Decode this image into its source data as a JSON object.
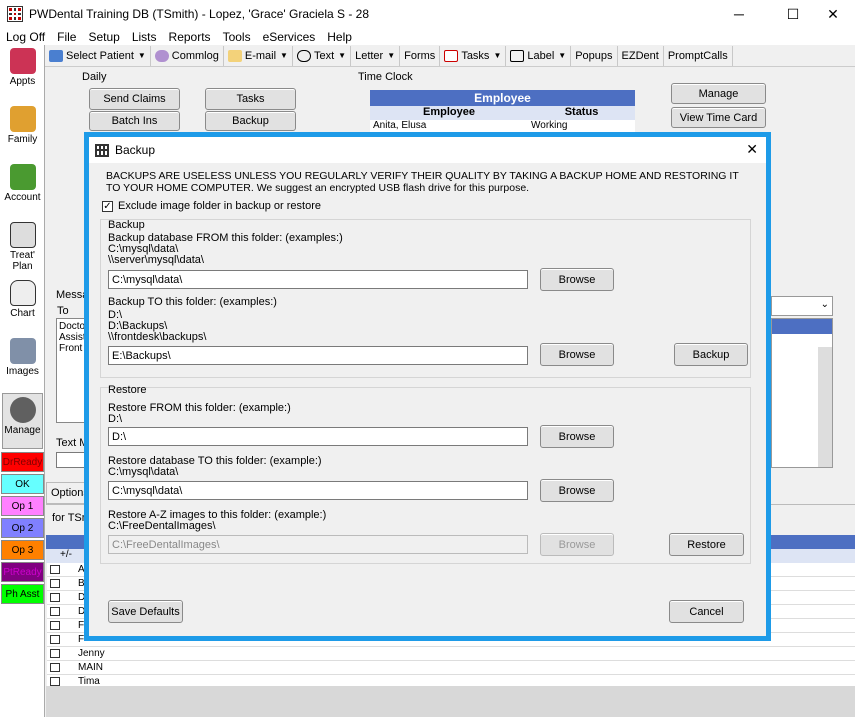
{
  "window": {
    "title": "PWDental Training DB (TSmith) - Lopez, 'Grace' Graciela S - 28",
    "minimize": "─",
    "maximize": "☐",
    "close": "✕"
  },
  "menu": [
    "Log Off",
    "File",
    "Setup",
    "Lists",
    "Reports",
    "Tools",
    "eServices",
    "Help"
  ],
  "toolbar": {
    "select_patient": "Select Patient",
    "commlog": "Commlog",
    "email": "E-mail",
    "text": "Text",
    "letter": "Letter",
    "forms": "Forms",
    "tasks": "Tasks",
    "label": "Label",
    "popups": "Popups",
    "ezdent": "EZDent",
    "promptcalls": "PromptCalls"
  },
  "modules": [
    "Appts",
    "Family",
    "Account",
    "Treat' Plan",
    "Chart",
    "Images",
    "Manage"
  ],
  "statuses": [
    {
      "label": "DrReady",
      "color": "#ff0000"
    },
    {
      "label": "OK",
      "color": "#66ffff"
    },
    {
      "label": "Op 1",
      "color": "#ff80ff"
    },
    {
      "label": "Op 2",
      "color": "#8080ff"
    },
    {
      "label": "Op 3",
      "color": "#ff8000"
    },
    {
      "label": "PtReady",
      "color": "#800080"
    },
    {
      "label": "Ph Asst",
      "color": "#00ff00"
    }
  ],
  "manage": {
    "daily_label": "Daily",
    "send_claims": "Send Claims",
    "tasks": "Tasks",
    "batch_ins": "Batch Ins",
    "backup": "Backup",
    "time_clock_label": "Time Clock",
    "employee_header": "Employee",
    "col_employee": "Employee",
    "col_status": "Status",
    "emp_name": "Anita, Elusa",
    "emp_status": "Working",
    "manage_btn": "Manage",
    "view_time_card": "View Time Card",
    "messaging_label": "Messa",
    "to_label": "To",
    "to_items": [
      "Doctor",
      "Assista",
      "Front"
    ],
    "text_msg_label": "Text M",
    "options_tab": "Options",
    "for_label": "for TSmi",
    "grid_header": "+/-",
    "grid_rows": [
      "A",
      "B",
      "D",
      "D",
      "F",
      "F",
      "Jenny",
      "MAIN",
      "Tima"
    ]
  },
  "dialog": {
    "title": "Backup",
    "warning": "BACKUPS ARE USELESS UNLESS YOU REGULARLY VERIFY THEIR QUALITY BY TAKING A BACKUP HOME AND RESTORING IT TO YOUR HOME COMPUTER.  We suggest an encrypted USB flash drive for this purpose.",
    "exclude_label": "Exclude image folder in backup or restore",
    "exclude_checked": true,
    "backup_group": "Backup",
    "from_label": "Backup database FROM this folder: (examples:)",
    "from_ex1": "C:\\mysql\\data\\",
    "from_ex2": "\\\\server\\mysql\\data\\",
    "from_value": "C:\\mysql\\data\\",
    "to_label": "Backup TO this folder: (examples:)",
    "to_ex1": "D:\\",
    "to_ex2": "D:\\Backups\\",
    "to_ex3": "\\\\frontdesk\\backups\\",
    "to_value": "E:\\Backups\\",
    "browse": "Browse",
    "backup_btn": "Backup",
    "restore_group": "Restore",
    "rfrom_label": "Restore FROM this folder: (example:)",
    "rfrom_ex": "D:\\",
    "rfrom_value": "D:\\",
    "rdb_label": "Restore database  TO this folder: (example:)",
    "rdb_ex": "C:\\mysql\\data\\",
    "rdb_value": "C:\\mysql\\data\\",
    "raz_label": "Restore A-Z images to this folder: (example:)",
    "raz_ex": "C:\\FreeDentalImages\\",
    "raz_value": "C:\\FreeDentalImages\\",
    "restore_btn": "Restore",
    "save_defaults": "Save Defaults",
    "cancel": "Cancel"
  }
}
